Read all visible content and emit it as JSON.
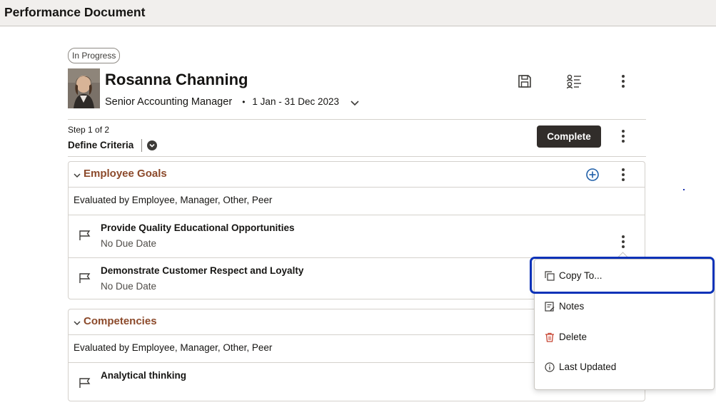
{
  "header": {
    "title": "Performance Document"
  },
  "document": {
    "status": "In Progress",
    "employee_name": "Rosanna Channing",
    "job_title": "Senior Accounting Manager",
    "separator": "•",
    "period": "1 Jan - 31 Dec 2023"
  },
  "step": {
    "counter": "Step 1 of 2",
    "name": "Define Criteria",
    "complete_label": "Complete"
  },
  "sections": [
    {
      "title": "Employee Goals",
      "evaluated_by": "Evaluated by Employee, Manager, Other, Peer",
      "items": [
        {
          "title": "Provide Quality Educational Opportunities",
          "due": "No Due Date"
        },
        {
          "title": "Demonstrate Customer Respect and Loyalty",
          "due": "No Due Date"
        }
      ]
    },
    {
      "title": "Competencies",
      "evaluated_by": "Evaluated by Employee, Manager, Other, Peer",
      "items": [
        {
          "title": "Analytical thinking",
          "due": ""
        }
      ]
    }
  ],
  "context_menu": {
    "items": [
      {
        "label": "Copy To...",
        "icon": "copy-icon"
      },
      {
        "label": "Notes",
        "icon": "notes-icon"
      },
      {
        "label": "Delete",
        "icon": "trash-icon"
      },
      {
        "label": "Last Updated",
        "icon": "info-icon"
      }
    ]
  },
  "colors": {
    "section_title": "#8c4a2b",
    "focus": "#0b32b8",
    "primary_button": "#312d2a",
    "add_icon": "#1f5fa8",
    "delete_icon": "#c74634"
  }
}
